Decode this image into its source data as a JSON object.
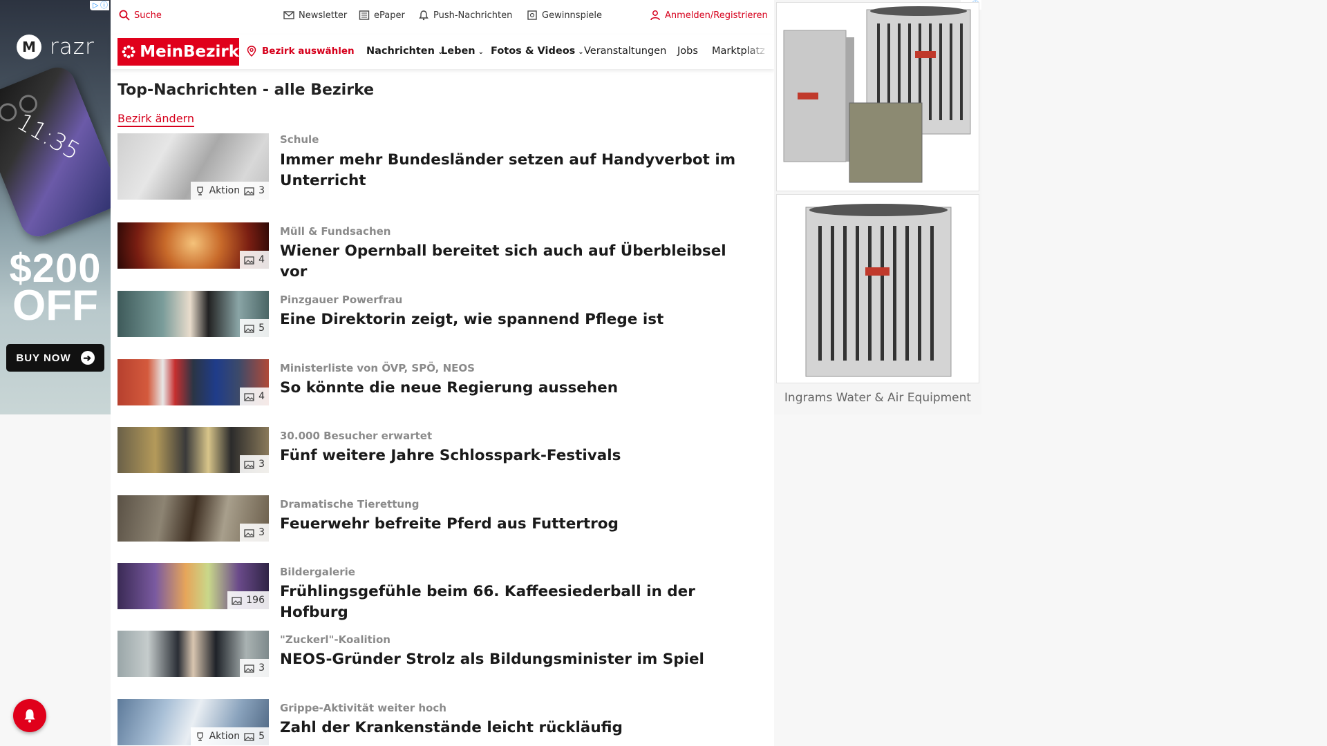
{
  "left_ad": {
    "brand": "razr",
    "phone_time": "11:35",
    "promo_amount": "$200",
    "promo_off": "OFF",
    "cta": "BUY NOW"
  },
  "utility": {
    "search": "Suche",
    "newsletter": "Newsletter",
    "epaper": "ePaper",
    "push": "Push-Nachrichten",
    "games": "Gewinnspiele",
    "login": "Anmelden/Registrieren"
  },
  "nav": {
    "logo": "MeinBezirk",
    "district": "Bezirk auswählen",
    "items": [
      "Nachrichten",
      "Leben",
      "Fotos & Videos",
      "Veranstaltungen",
      "Jobs",
      "Marktplatz"
    ]
  },
  "page": {
    "title": "Top-Nachrichten - alle Bezirke",
    "change_district": "Bezirk ändern"
  },
  "articles": [
    {
      "kicker": "Schule",
      "headline": "Immer mehr Bundesländer setzen auf Handyverbot im Unterricht",
      "action": "Aktion",
      "images": "3"
    },
    {
      "kicker": "Müll & Fundsachen",
      "headline": "Wiener Opernball bereitet sich auch auf Überbleibsel vor",
      "images": "4"
    },
    {
      "kicker": "Pinzgauer Powerfrau",
      "headline": "Eine Direktorin zeigt, wie spannend Pflege ist",
      "images": "5"
    },
    {
      "kicker": "Ministerliste von ÖVP, SPÖ, NEOS",
      "headline": "So könnte die neue Regierung aussehen",
      "images": "4"
    },
    {
      "kicker": "30.000 Besucher erwartet",
      "headline": "Fünf weitere Jahre Schlosspark-Festivals",
      "images": "3"
    },
    {
      "kicker": "Dramatische Tierettung",
      "headline": "Feuerwehr befreite Pferd aus Futtertrog",
      "images": "3"
    },
    {
      "kicker": "Bildergalerie",
      "headline": "Frühlingsgefühle beim 66. Kaffeesiederball in der Hofburg",
      "images": "196"
    },
    {
      "kicker": "\"Zuckerl\"-Koalition",
      "headline": "NEOS-Gründer Strolz als Bildungsminister im Spiel",
      "images": "3"
    },
    {
      "kicker": "Grippe-Aktivität weiter hoch",
      "headline": "Zahl der Krankenstände leicht rückläufig",
      "action": "Aktion",
      "images": "5"
    }
  ],
  "right_ad": {
    "advertiser": "Ingrams Water & Air Equipment"
  },
  "colors": {
    "brand_red": "#e0001b",
    "link_red": "#d6001c",
    "kicker_gray": "#8a8a8a"
  }
}
